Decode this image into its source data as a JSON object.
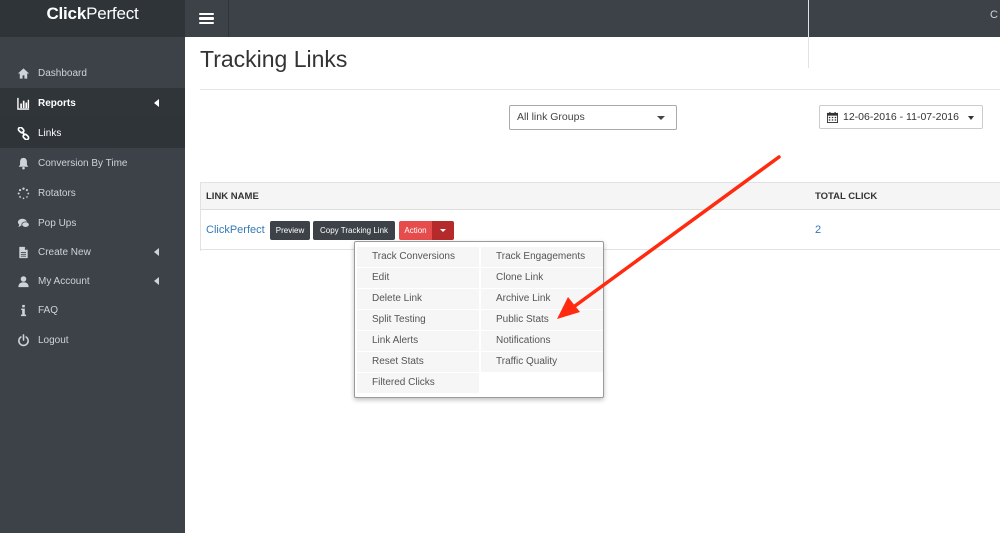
{
  "app": {
    "logo_bold": "Click",
    "logo_rest": "Perfect",
    "user_initial": "C"
  },
  "sidebar": {
    "items": [
      {
        "label": "Dashboard",
        "icon": "home-icon"
      },
      {
        "label": "Reports",
        "icon": "bar-chart-icon",
        "has_caret": true,
        "state": "expanded"
      },
      {
        "label": "Links",
        "icon": "link-icon",
        "state": "current"
      },
      {
        "label": "Conversion By Time",
        "icon": "bell-icon"
      },
      {
        "label": "Rotators",
        "icon": "spinner-icon"
      },
      {
        "label": "Pop Ups",
        "icon": "comments-icon"
      },
      {
        "label": "Create New",
        "icon": "file-icon",
        "has_caret": true
      },
      {
        "label": "My Account",
        "icon": "user-icon",
        "has_caret": true
      },
      {
        "label": "FAQ",
        "icon": "info-icon"
      },
      {
        "label": "Logout",
        "icon": "power-icon"
      }
    ]
  },
  "main": {
    "title": "Tracking Links",
    "group_filter": {
      "value": "All link Groups"
    },
    "date_range": {
      "value": "12-06-2016 - 11-07-2016"
    },
    "table": {
      "columns": [
        "LINK NAME",
        "TOTAL CLICK"
      ],
      "rows": [
        {
          "link_name": "ClickPerfect",
          "preview": "Preview",
          "copy": "Copy Tracking Link",
          "action": "Action",
          "total_click": "2"
        }
      ]
    },
    "action_menu": {
      "left": [
        "Track Conversions",
        "Edit",
        "Delete Link",
        "Split Testing",
        "Link Alerts",
        "Reset Stats",
        "Filtered Clicks"
      ],
      "right": [
        "Track Engagements",
        "Clone Link",
        "Archive Link",
        "Public Stats",
        "Notifications",
        "Traffic Quality"
      ]
    }
  },
  "colors": {
    "sidebar": "#3c4248",
    "action": "#e74c4c",
    "link": "#337ab7",
    "annotation_arrow": "#ff2a10"
  }
}
